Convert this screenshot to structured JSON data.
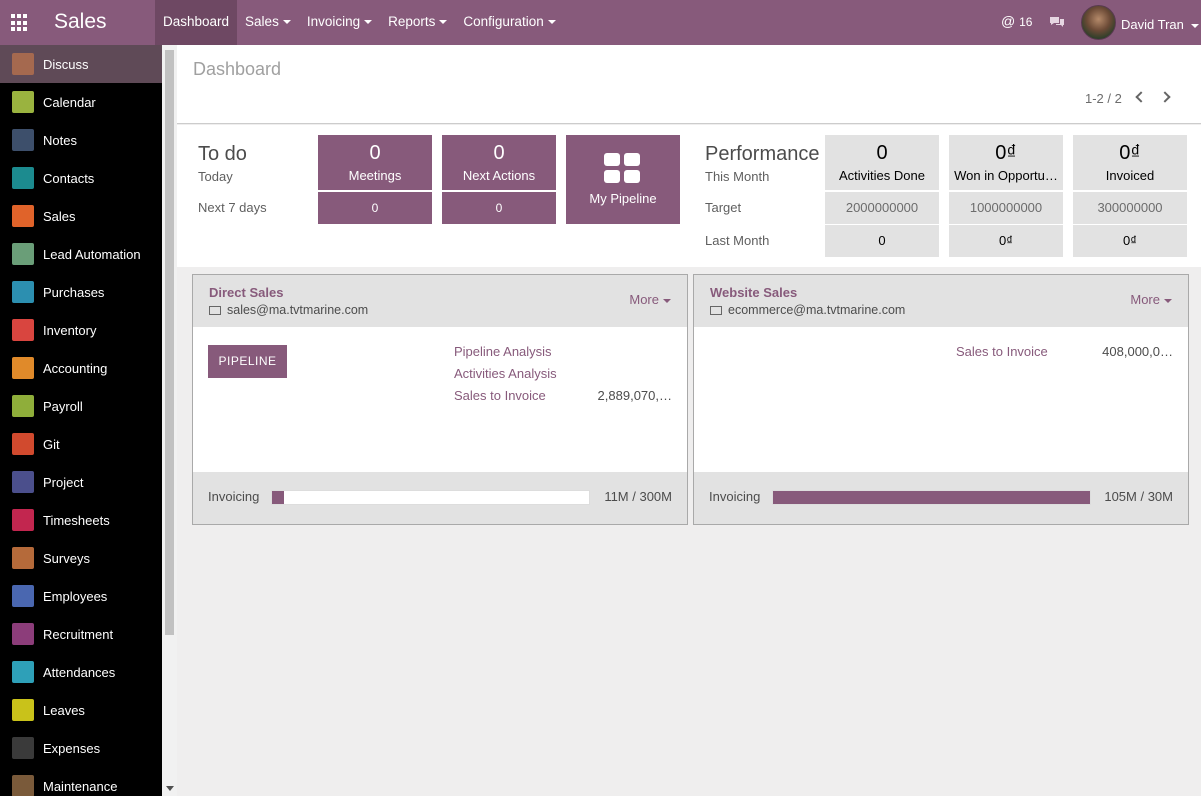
{
  "app": {
    "title": "Sales"
  },
  "menu": {
    "items": [
      {
        "label": "Dashboard",
        "active": true
      },
      {
        "label": "Sales"
      },
      {
        "label": "Invoicing"
      },
      {
        "label": "Reports"
      },
      {
        "label": "Configuration"
      }
    ]
  },
  "topbar": {
    "mentions": "16",
    "user_name": "David Tran"
  },
  "sidebar": {
    "items": [
      {
        "label": "Discuss",
        "icon": "discuss-icon",
        "color": "#a5694f"
      },
      {
        "label": "Calendar",
        "icon": "calendar-icon",
        "color": "#9ab33f"
      },
      {
        "label": "Notes",
        "icon": "notes-icon",
        "color": "#3d4f6b"
      },
      {
        "label": "Contacts",
        "icon": "contacts-icon",
        "color": "#1c8b8f"
      },
      {
        "label": "Sales",
        "icon": "sales-icon",
        "color": "#e0632a"
      },
      {
        "label": "Lead Automation",
        "icon": "lead-automation-icon",
        "color": "#6a9e78"
      },
      {
        "label": "Purchases",
        "icon": "purchases-icon",
        "color": "#2c8fb0"
      },
      {
        "label": "Inventory",
        "icon": "inventory-icon",
        "color": "#d9453f"
      },
      {
        "label": "Accounting",
        "icon": "accounting-icon",
        "color": "#e08a2a"
      },
      {
        "label": "Payroll",
        "icon": "payroll-icon",
        "color": "#8fae3a"
      },
      {
        "label": "Git",
        "icon": "git-icon",
        "color": "#d14a2e"
      },
      {
        "label": "Project",
        "icon": "project-icon",
        "color": "#4b4f8c"
      },
      {
        "label": "Timesheets",
        "icon": "timesheets-icon",
        "color": "#c2264f"
      },
      {
        "label": "Surveys",
        "icon": "surveys-icon",
        "color": "#b56a3a"
      },
      {
        "label": "Employees",
        "icon": "employees-icon",
        "color": "#4a67b0"
      },
      {
        "label": "Recruitment",
        "icon": "recruitment-icon",
        "color": "#8c3d7a"
      },
      {
        "label": "Attendances",
        "icon": "attendances-icon",
        "color": "#2ea0b8"
      },
      {
        "label": "Leaves",
        "icon": "leaves-icon",
        "color": "#c9c21a"
      },
      {
        "label": "Expenses",
        "icon": "expenses-icon",
        "color": "#3a3a3a"
      },
      {
        "label": "Maintenance",
        "icon": "maintenance-icon",
        "color": "#7a5a3a"
      }
    ]
  },
  "breadcrumb": {
    "title": "Dashboard"
  },
  "pager": {
    "value": "1-2 / 2"
  },
  "todo": {
    "title": "To do",
    "today_label": "Today",
    "next7_label": "Next 7 days",
    "meetings": {
      "value": "0",
      "label": "Meetings",
      "next7": "0"
    },
    "next_actions": {
      "value": "0",
      "label": "Next Actions",
      "next7": "0"
    },
    "pipeline_label": "My Pipeline"
  },
  "performance": {
    "title": "Performance",
    "this_month_label": "This Month",
    "target_label": "Target",
    "last_month_label": "Last Month",
    "activities": {
      "value": "0",
      "label": "Activities Done",
      "target": "2000000000",
      "last": "0"
    },
    "won": {
      "value": "0₫",
      "label": "Won in Opportu…",
      "target": "1000000000",
      "last": "0₫"
    },
    "invoiced": {
      "value": "0₫",
      "label": "Invoiced",
      "target": "300000000",
      "last": "0₫"
    }
  },
  "cards": [
    {
      "title": "Direct Sales",
      "email": "sales@ma.tvtmarine.com",
      "more": "More",
      "button": "PIPELINE",
      "links": [
        "Pipeline Analysis",
        "Activities Analysis",
        "Sales to Invoice"
      ],
      "sales_to_invoice_value": "2,889,070,…",
      "invoicing_label": "Invoicing",
      "invoicing_value": "11M / 300M",
      "invoicing_progress": 0.037
    },
    {
      "title": "Website Sales",
      "email": "ecommerce@ma.tvtmarine.com",
      "more": "More",
      "links": [
        "Sales to Invoice"
      ],
      "sales_to_invoice_value": "408,000,0…",
      "invoicing_label": "Invoicing",
      "invoicing_value": "105M / 30M",
      "invoicing_progress": 1.0
    }
  ],
  "colors": {
    "brand": "#875a7b",
    "sidebar": "#000000",
    "tile_grey": "#e2e2e2"
  }
}
